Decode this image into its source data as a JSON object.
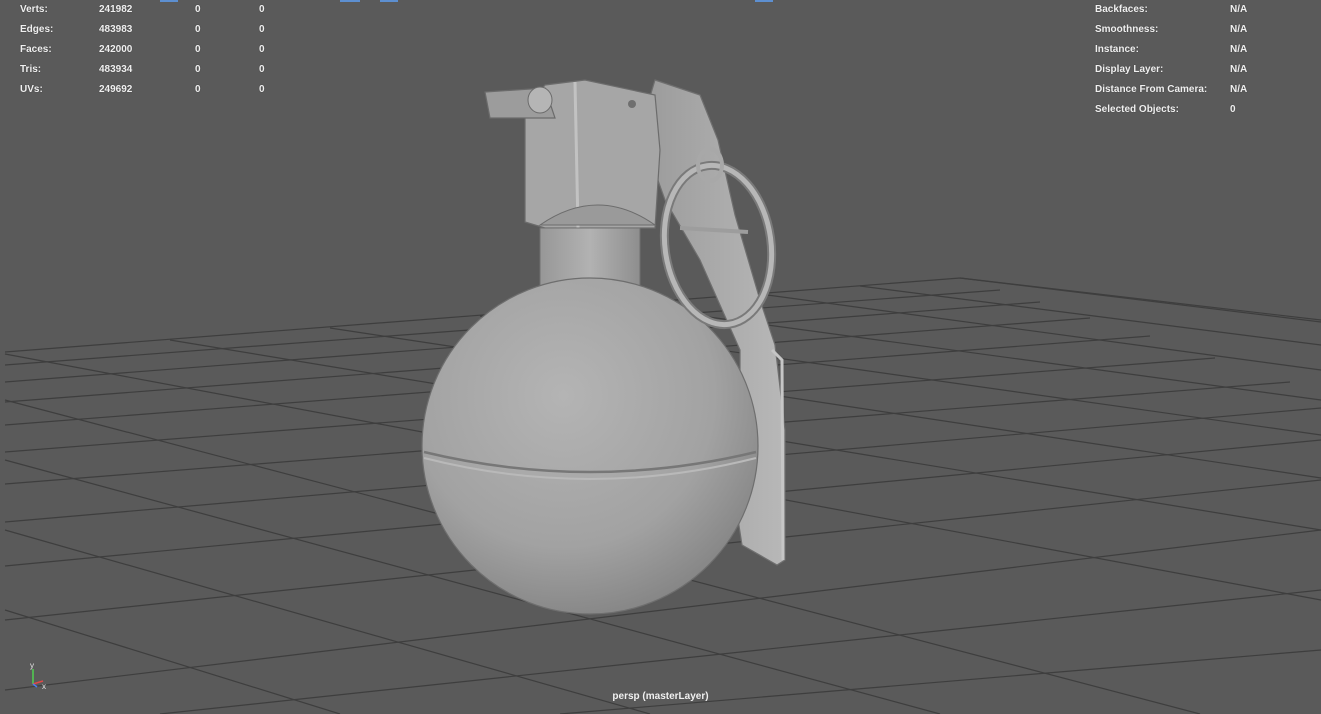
{
  "heads_up": {
    "poly_count": [
      {
        "label": "Verts:",
        "v1": "241982",
        "v2": "0",
        "v3": "0"
      },
      {
        "label": "Edges:",
        "v1": "483983",
        "v2": "0",
        "v3": "0"
      },
      {
        "label": "Faces:",
        "v1": "242000",
        "v2": "0",
        "v3": "0"
      },
      {
        "label": "Tris:",
        "v1": "483934",
        "v2": "0",
        "v3": "0"
      },
      {
        "label": "UVs:",
        "v1": "249692",
        "v2": "0",
        "v3": "0"
      }
    ],
    "object_details": [
      {
        "label": "Backfaces:",
        "value": "N/A"
      },
      {
        "label": "Smoothness:",
        "value": "N/A"
      },
      {
        "label": "Instance:",
        "value": "N/A"
      },
      {
        "label": "Display Layer:",
        "value": "N/A"
      },
      {
        "label": "Distance From Camera:",
        "value": "N/A"
      },
      {
        "label": "Selected Objects:",
        "value": "0"
      }
    ]
  },
  "camera_label": "persp (masterLayer)",
  "axis_gizmo": {
    "y_label": "y",
    "x_label": "x"
  },
  "colors": {
    "background": "#5a5a5a",
    "grid": "#3c3c3c",
    "model": "#a9a9a9",
    "text": "#f0f0f0"
  }
}
